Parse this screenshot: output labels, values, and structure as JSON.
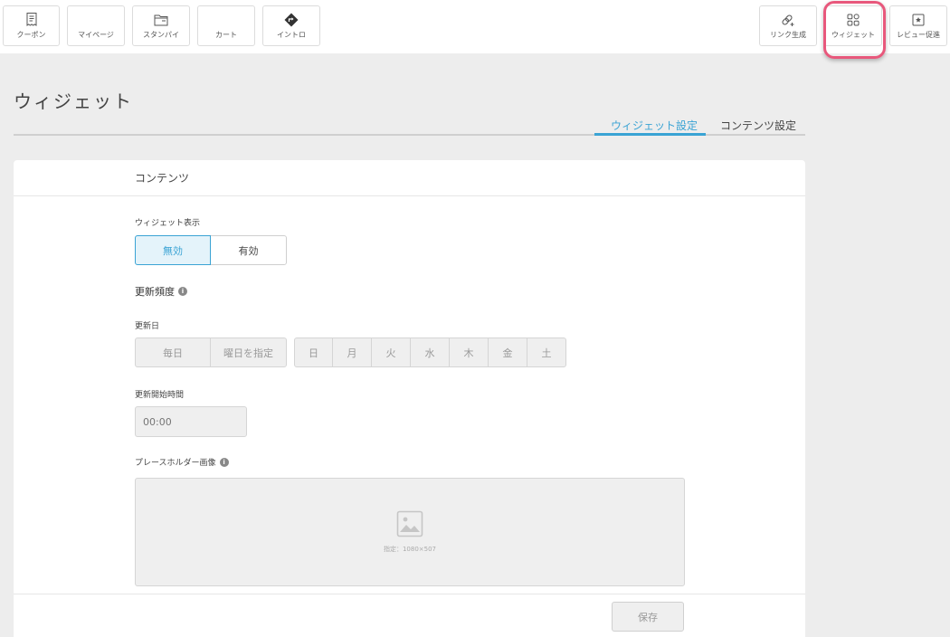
{
  "nav_left": [
    {
      "label": "クーポン",
      "icon": "receipt-icon"
    },
    {
      "label": "マイページ",
      "icon": "user-page-icon"
    },
    {
      "label": "スタンパイ",
      "icon": "folder-icon"
    },
    {
      "label": "カート",
      "icon": "cart-icon"
    },
    {
      "label": "イントロ",
      "icon": "direction-sign-icon"
    }
  ],
  "nav_right": [
    {
      "label": "リンク生成",
      "icon": "link-add-icon"
    },
    {
      "label": "ウィジェット",
      "icon": "widget-grid-icon"
    },
    {
      "label": "レビュー促進",
      "icon": "review-icon"
    }
  ],
  "highlight_color": "#e8587c",
  "accent_color": "#3aa3d4",
  "page_title": "ウィジェット",
  "tabs": [
    {
      "label": "ウィジェット設定",
      "active": true
    },
    {
      "label": "コンテンツ設定",
      "active": false
    }
  ],
  "card": {
    "title": "コンテンツ",
    "widget_display": {
      "label": "ウィジェット表示",
      "options": [
        "無効",
        "有効"
      ],
      "selected": "無効"
    },
    "update_frequency": {
      "label": "更新頻度"
    },
    "update_day": {
      "label": "更新日",
      "modes": [
        "毎日",
        "曜日を指定"
      ],
      "weekdays": [
        "日",
        "月",
        "火",
        "水",
        "木",
        "金",
        "土"
      ]
    },
    "start_time": {
      "label": "更新開始時間",
      "placeholder": "00:00"
    },
    "placeholder_image": {
      "label": "プレースホルダー画像",
      "caption": "指定：1080×507"
    },
    "save_label": "保存"
  }
}
